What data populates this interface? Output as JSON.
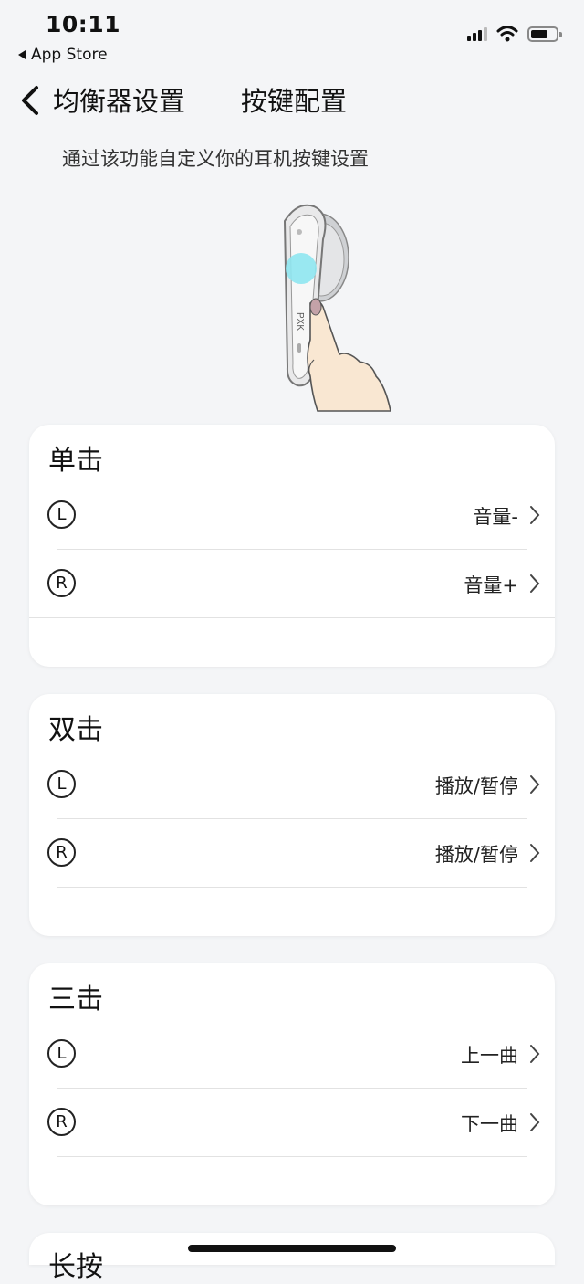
{
  "status_bar": {
    "time": "10:11",
    "back_app": "App Store"
  },
  "header": {
    "tab_eq": "均衡器设置",
    "tab_keys": "按键配置"
  },
  "subtitle": "通过该功能自定义你的耳机按键设置",
  "cards": {
    "single": {
      "title": "单击",
      "left_badge": "L",
      "left_value": "音量-",
      "right_badge": "R",
      "right_value": "音量+"
    },
    "double": {
      "title": "双击",
      "left_badge": "L",
      "left_value": "播放/暂停",
      "right_badge": "R",
      "right_value": "播放/暂停"
    },
    "triple": {
      "title": "三击",
      "left_badge": "L",
      "left_value": "上一曲",
      "right_badge": "R",
      "right_value": "下一曲"
    },
    "long": {
      "title": "长按"
    }
  },
  "icons": [
    "back-chevron-icon",
    "chevron-right-icon",
    "wifi-icon",
    "signal-icon",
    "battery-icon"
  ],
  "colors": {
    "background": "#f4f5f7",
    "card": "#ffffff",
    "accent_touch": "#8ee6ef"
  }
}
